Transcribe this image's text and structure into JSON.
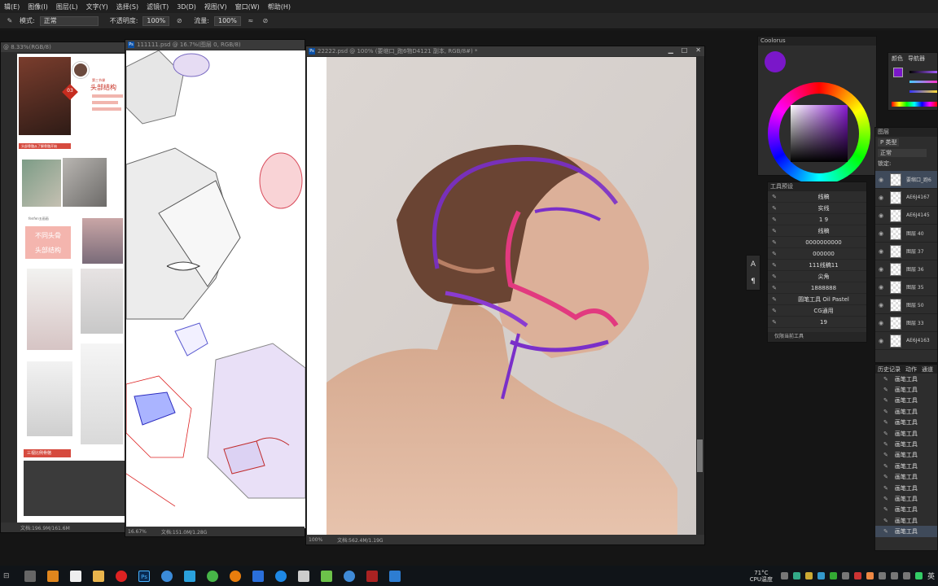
{
  "menu": [
    "辑(E)",
    "图像(I)",
    "图层(L)",
    "文字(Y)",
    "选择(S)",
    "滤镜(T)",
    "3D(D)",
    "视图(V)",
    "窗口(W)",
    "帮助(H)"
  ],
  "options": {
    "mode_label": "模式:",
    "mode_value": "正常",
    "opacity_label": "不透明度:",
    "opacity_value": "100%",
    "flow_label": "流量:",
    "flow_value": "100%"
  },
  "doc1": {
    "title": "@ 8.33%(RGB/8)",
    "zoom": "",
    "info": "文档:196.9M/161.6M"
  },
  "doc1_page": {
    "badge": "03",
    "chapter": "第三节课",
    "heading": "头部结构",
    "section_header": "头部骨骼从了解骨骼开始",
    "caption_small": "fenfen五画画",
    "box_line1": "不同头骨",
    "box_line2": "头部结构",
    "footer_header": "三视比例骨骼"
  },
  "doc2": {
    "title": "111111.psd @ 16.7%(图层 0, RGB/8)",
    "zoom": "16.67%",
    "info": "文档:151.0M/1.28G"
  },
  "doc3": {
    "title": "22222.psd @ 100% (要缩口_跑6物D4121 副本, RGB/8#) *",
    "zoom": "100%",
    "info": "文档:562.4M/1.19G"
  },
  "coolorus": {
    "title": "Coolorus",
    "accent": "#7a17c9"
  },
  "tool_presets": {
    "title": "工具预设",
    "items": [
      "线稿",
      "实线",
      "1 9",
      "线稿",
      "0000000000",
      "000000",
      "111线稿11",
      "尖角",
      "1888888",
      "圆笔工具 Oil Pastel",
      "CG通用",
      "19"
    ],
    "footer": "仅限当前工具"
  },
  "color_panel": {
    "tabs": [
      "颜色",
      "导航器"
    ]
  },
  "layers": {
    "title": "图层",
    "kind_label": "P 类型",
    "blend_value": "正常",
    "lock_label": "锁定:",
    "items": [
      "要缩口_跑6",
      "AE6J4167",
      "AE6J4145",
      "图层 40",
      "图层 37",
      "图层 36",
      "图层 35",
      "图层 50",
      "图层 33",
      "AE6J4163"
    ]
  },
  "history": {
    "tabs": [
      "历史记录",
      "动作",
      "通道"
    ],
    "items": [
      "画笔工具",
      "画笔工具",
      "画笔工具",
      "画笔工具",
      "画笔工具",
      "画笔工具",
      "画笔工具",
      "画笔工具",
      "画笔工具",
      "画笔工具",
      "画笔工具",
      "画笔工具",
      "画笔工具",
      "画笔工具",
      "画笔工具"
    ]
  },
  "mini_tools": [
    "A",
    "¶"
  ],
  "tray": {
    "temp": "71°C",
    "cpu_label": "CPU温度",
    "lang": "英"
  }
}
